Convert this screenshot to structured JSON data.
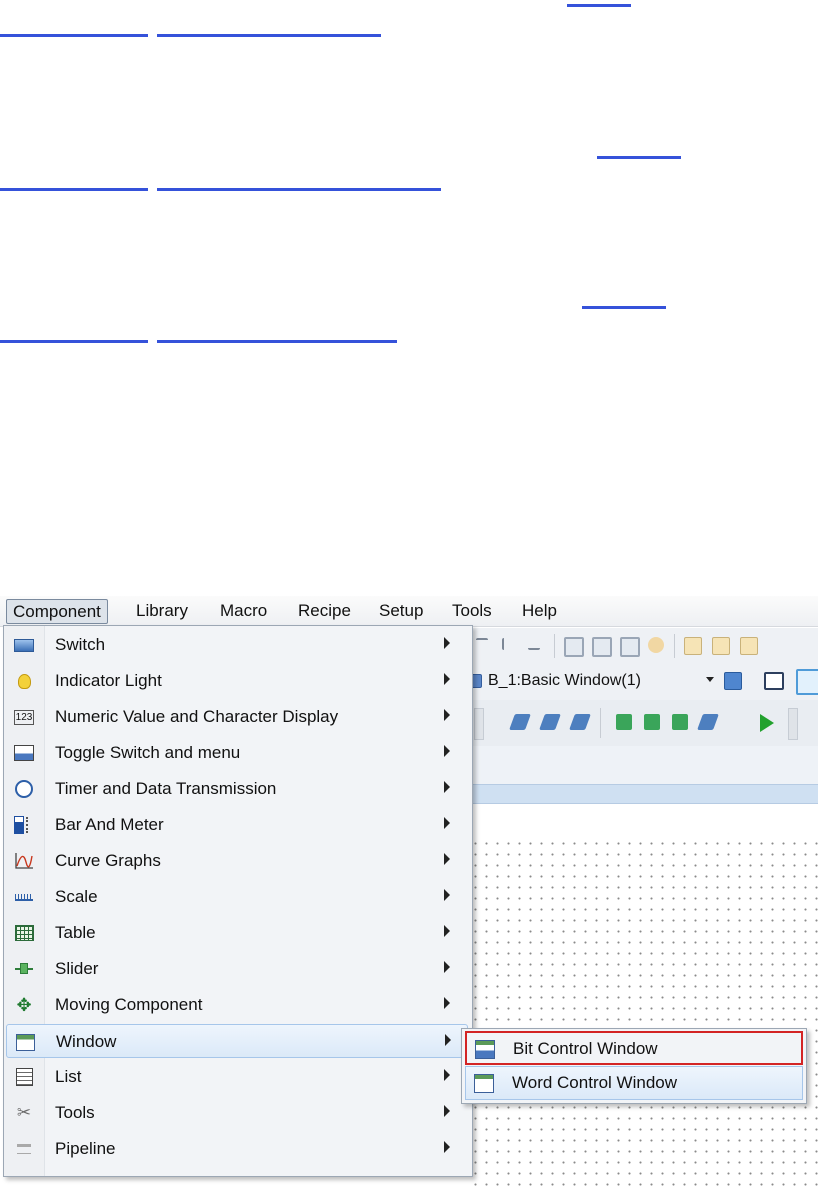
{
  "menubar": {
    "items": [
      "Component",
      "Library",
      "Macro",
      "Recipe",
      "Setup",
      "Tools",
      "Help"
    ]
  },
  "toolbar": {
    "window_selector": "B_1:Basic Window(1)"
  },
  "component_menu": {
    "items": [
      {
        "label": "Switch",
        "icon": "switch-icon"
      },
      {
        "label": "Indicator Light",
        "icon": "lightbulb-icon"
      },
      {
        "label": "Numeric Value and Character Display",
        "icon": "numeric-123-icon"
      },
      {
        "label": "Toggle Switch and menu",
        "icon": "toggle-switch-icon"
      },
      {
        "label": "Timer and Data Transmission",
        "icon": "clock-icon"
      },
      {
        "label": "Bar And Meter",
        "icon": "bar-meter-icon"
      },
      {
        "label": "Curve Graphs",
        "icon": "curve-graph-icon"
      },
      {
        "label": "Scale",
        "icon": "scale-icon"
      },
      {
        "label": "Table",
        "icon": "table-icon"
      },
      {
        "label": "Slider",
        "icon": "slider-icon"
      },
      {
        "label": "Moving Component",
        "icon": "move-arrows-icon"
      },
      {
        "label": "Window",
        "icon": "window-icon"
      },
      {
        "label": "List",
        "icon": "list-icon"
      },
      {
        "label": "Tools",
        "icon": "tools-icon"
      },
      {
        "label": "Pipeline",
        "icon": "pipeline-icon"
      }
    ],
    "highlighted": "Window"
  },
  "window_submenu": {
    "items": [
      {
        "label": "Bit Control Window",
        "icon": "bit-control-window-icon"
      },
      {
        "label": "Word Control Window",
        "icon": "word-control-window-icon"
      }
    ],
    "outlined": "Bit Control Window"
  },
  "colors": {
    "highlight": "#dbe9f8",
    "outline": "#d32424",
    "link": "#1f3fd6"
  }
}
